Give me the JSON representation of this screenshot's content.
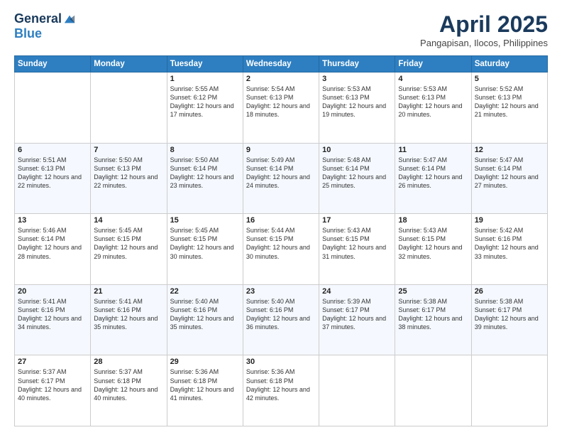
{
  "header": {
    "logo_general": "General",
    "logo_blue": "Blue",
    "month_title": "April 2025",
    "subtitle": "Pangapisan, Ilocos, Philippines"
  },
  "days_of_week": [
    "Sunday",
    "Monday",
    "Tuesday",
    "Wednesday",
    "Thursday",
    "Friday",
    "Saturday"
  ],
  "weeks": [
    [
      {
        "day": "",
        "sunrise": "",
        "sunset": "",
        "daylight": ""
      },
      {
        "day": "",
        "sunrise": "",
        "sunset": "",
        "daylight": ""
      },
      {
        "day": "1",
        "sunrise": "Sunrise: 5:55 AM",
        "sunset": "Sunset: 6:12 PM",
        "daylight": "Daylight: 12 hours and 17 minutes."
      },
      {
        "day": "2",
        "sunrise": "Sunrise: 5:54 AM",
        "sunset": "Sunset: 6:13 PM",
        "daylight": "Daylight: 12 hours and 18 minutes."
      },
      {
        "day": "3",
        "sunrise": "Sunrise: 5:53 AM",
        "sunset": "Sunset: 6:13 PM",
        "daylight": "Daylight: 12 hours and 19 minutes."
      },
      {
        "day": "4",
        "sunrise": "Sunrise: 5:53 AM",
        "sunset": "Sunset: 6:13 PM",
        "daylight": "Daylight: 12 hours and 20 minutes."
      },
      {
        "day": "5",
        "sunrise": "Sunrise: 5:52 AM",
        "sunset": "Sunset: 6:13 PM",
        "daylight": "Daylight: 12 hours and 21 minutes."
      }
    ],
    [
      {
        "day": "6",
        "sunrise": "Sunrise: 5:51 AM",
        "sunset": "Sunset: 6:13 PM",
        "daylight": "Daylight: 12 hours and 22 minutes."
      },
      {
        "day": "7",
        "sunrise": "Sunrise: 5:50 AM",
        "sunset": "Sunset: 6:13 PM",
        "daylight": "Daylight: 12 hours and 22 minutes."
      },
      {
        "day": "8",
        "sunrise": "Sunrise: 5:50 AM",
        "sunset": "Sunset: 6:14 PM",
        "daylight": "Daylight: 12 hours and 23 minutes."
      },
      {
        "day": "9",
        "sunrise": "Sunrise: 5:49 AM",
        "sunset": "Sunset: 6:14 PM",
        "daylight": "Daylight: 12 hours and 24 minutes."
      },
      {
        "day": "10",
        "sunrise": "Sunrise: 5:48 AM",
        "sunset": "Sunset: 6:14 PM",
        "daylight": "Daylight: 12 hours and 25 minutes."
      },
      {
        "day": "11",
        "sunrise": "Sunrise: 5:47 AM",
        "sunset": "Sunset: 6:14 PM",
        "daylight": "Daylight: 12 hours and 26 minutes."
      },
      {
        "day": "12",
        "sunrise": "Sunrise: 5:47 AM",
        "sunset": "Sunset: 6:14 PM",
        "daylight": "Daylight: 12 hours and 27 minutes."
      }
    ],
    [
      {
        "day": "13",
        "sunrise": "Sunrise: 5:46 AM",
        "sunset": "Sunset: 6:14 PM",
        "daylight": "Daylight: 12 hours and 28 minutes."
      },
      {
        "day": "14",
        "sunrise": "Sunrise: 5:45 AM",
        "sunset": "Sunset: 6:15 PM",
        "daylight": "Daylight: 12 hours and 29 minutes."
      },
      {
        "day": "15",
        "sunrise": "Sunrise: 5:45 AM",
        "sunset": "Sunset: 6:15 PM",
        "daylight": "Daylight: 12 hours and 30 minutes."
      },
      {
        "day": "16",
        "sunrise": "Sunrise: 5:44 AM",
        "sunset": "Sunset: 6:15 PM",
        "daylight": "Daylight: 12 hours and 30 minutes."
      },
      {
        "day": "17",
        "sunrise": "Sunrise: 5:43 AM",
        "sunset": "Sunset: 6:15 PM",
        "daylight": "Daylight: 12 hours and 31 minutes."
      },
      {
        "day": "18",
        "sunrise": "Sunrise: 5:43 AM",
        "sunset": "Sunset: 6:15 PM",
        "daylight": "Daylight: 12 hours and 32 minutes."
      },
      {
        "day": "19",
        "sunrise": "Sunrise: 5:42 AM",
        "sunset": "Sunset: 6:16 PM",
        "daylight": "Daylight: 12 hours and 33 minutes."
      }
    ],
    [
      {
        "day": "20",
        "sunrise": "Sunrise: 5:41 AM",
        "sunset": "Sunset: 6:16 PM",
        "daylight": "Daylight: 12 hours and 34 minutes."
      },
      {
        "day": "21",
        "sunrise": "Sunrise: 5:41 AM",
        "sunset": "Sunset: 6:16 PM",
        "daylight": "Daylight: 12 hours and 35 minutes."
      },
      {
        "day": "22",
        "sunrise": "Sunrise: 5:40 AM",
        "sunset": "Sunset: 6:16 PM",
        "daylight": "Daylight: 12 hours and 35 minutes."
      },
      {
        "day": "23",
        "sunrise": "Sunrise: 5:40 AM",
        "sunset": "Sunset: 6:16 PM",
        "daylight": "Daylight: 12 hours and 36 minutes."
      },
      {
        "day": "24",
        "sunrise": "Sunrise: 5:39 AM",
        "sunset": "Sunset: 6:17 PM",
        "daylight": "Daylight: 12 hours and 37 minutes."
      },
      {
        "day": "25",
        "sunrise": "Sunrise: 5:38 AM",
        "sunset": "Sunset: 6:17 PM",
        "daylight": "Daylight: 12 hours and 38 minutes."
      },
      {
        "day": "26",
        "sunrise": "Sunrise: 5:38 AM",
        "sunset": "Sunset: 6:17 PM",
        "daylight": "Daylight: 12 hours and 39 minutes."
      }
    ],
    [
      {
        "day": "27",
        "sunrise": "Sunrise: 5:37 AM",
        "sunset": "Sunset: 6:17 PM",
        "daylight": "Daylight: 12 hours and 40 minutes."
      },
      {
        "day": "28",
        "sunrise": "Sunrise: 5:37 AM",
        "sunset": "Sunset: 6:18 PM",
        "daylight": "Daylight: 12 hours and 40 minutes."
      },
      {
        "day": "29",
        "sunrise": "Sunrise: 5:36 AM",
        "sunset": "Sunset: 6:18 PM",
        "daylight": "Daylight: 12 hours and 41 minutes."
      },
      {
        "day": "30",
        "sunrise": "Sunrise: 5:36 AM",
        "sunset": "Sunset: 6:18 PM",
        "daylight": "Daylight: 12 hours and 42 minutes."
      },
      {
        "day": "",
        "sunrise": "",
        "sunset": "",
        "daylight": ""
      },
      {
        "day": "",
        "sunrise": "",
        "sunset": "",
        "daylight": ""
      },
      {
        "day": "",
        "sunrise": "",
        "sunset": "",
        "daylight": ""
      }
    ]
  ]
}
